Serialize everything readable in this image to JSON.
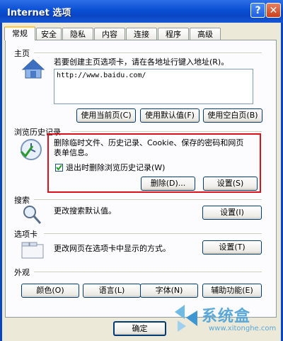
{
  "window": {
    "title": "Internet 选项",
    "help_label": "?",
    "close_label": "✕"
  },
  "tabs": [
    "常规",
    "安全",
    "隐私",
    "内容",
    "连接",
    "程序",
    "高级"
  ],
  "homepage": {
    "group_label": "主页",
    "instruction": "若要创建主页选项卡，请在各地址行键入地址(R)。",
    "url_value": "http://www.baidu.com/",
    "buttons": [
      "使用当前页(C)",
      "使用默认值(F)",
      "使用空白页(B)"
    ]
  },
  "history": {
    "group_label": "浏览历史记录",
    "description_line1": "删除临时文件、历史记录、Cookie、保存的密码和网页",
    "description_line2": "表单信息。",
    "checkbox_label": "退出时删除浏览历史记录(W)",
    "checkbox_checked": true,
    "delete_button": "删除(D)...",
    "settings_button": "设置(S)"
  },
  "search": {
    "group_label": "搜索",
    "description": "更改搜索默认值。",
    "settings_button": "设置(I)"
  },
  "tabs_section": {
    "group_label": "选项卡",
    "description": "更改网页在选项卡中显示的方式。",
    "settings_button": "设置(T)"
  },
  "appearance": {
    "group_label": "外观",
    "buttons": [
      "颜色(O)",
      "语言(L)",
      "字体(N)",
      "辅助功能(E)"
    ]
  },
  "footer": {
    "ok_button": "确定"
  },
  "watermark": {
    "brand": "系统盒",
    "url": "www.xitonghe.com"
  }
}
